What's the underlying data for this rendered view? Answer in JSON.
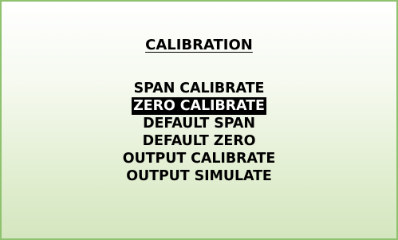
{
  "screen": {
    "title": "CALIBRATION",
    "selected_index": 1,
    "colors": {
      "border": "#8fc26f",
      "gradient_top": "#ffffff",
      "gradient_bottom": "#d4e6bf",
      "highlight_bg": "#000000",
      "highlight_fg": "#ffffff"
    }
  },
  "menu": {
    "items": [
      {
        "label": "SPAN CALIBRATE"
      },
      {
        "label": "ZERO CALIBRATE"
      },
      {
        "label": "DEFAULT SPAN"
      },
      {
        "label": "DEFAULT ZERO"
      },
      {
        "label": "OUTPUT CALIBRATE"
      },
      {
        "label": "OUTPUT SIMULATE"
      }
    ]
  }
}
